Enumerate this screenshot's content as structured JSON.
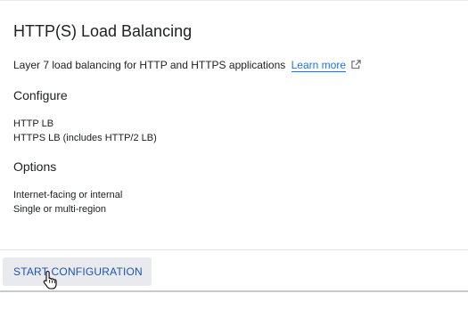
{
  "card": {
    "title": "HTTP(S) Load Balancing",
    "description": "Layer 7 load balancing for HTTP and HTTPS applications",
    "learn_more": "Learn more",
    "icons": {
      "external_link": "external-link-icon",
      "cursor": "hand-pointer-icon"
    },
    "configure": {
      "heading": "Configure",
      "items": [
        "HTTP LB",
        "HTTPS LB (includes HTTP/2 LB)"
      ]
    },
    "options": {
      "heading": "Options",
      "items": [
        "Internet-facing or internal",
        "Single or multi-region"
      ]
    },
    "action_button": "START CONFIGURATION"
  },
  "colors": {
    "link": "#1a73e8",
    "button_text": "#1a56b4",
    "button_bg": "#e8eaed",
    "text": "#202124"
  }
}
